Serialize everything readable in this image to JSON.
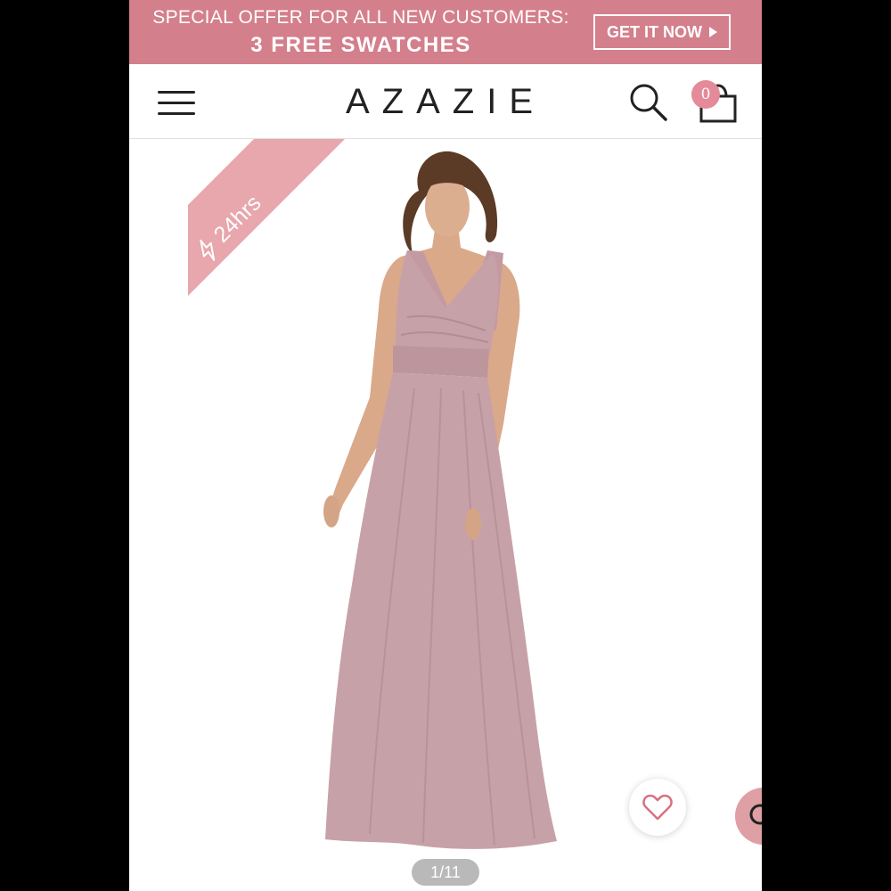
{
  "promo": {
    "line1": "SPECIAL OFFER FOR ALL NEW CUSTOMERS:",
    "line2": "3 FREE SWATCHES",
    "cta_label": "GET IT NOW",
    "background": "#d47f8c"
  },
  "header": {
    "logo": "AZAZIE",
    "cart_count": "0",
    "icons": [
      "hamburger-menu-icon",
      "search-icon",
      "shopping-bag-icon"
    ]
  },
  "product": {
    "badge_label": "24hrs",
    "badge_icon": "lightning-icon",
    "badge_color": "#e8a6ad",
    "dress_color": "#c7a1a8",
    "page_indicator": "1/11"
  },
  "actions": {
    "wishlist_icon": "heart-icon",
    "chat_icon": "chat-bubble-icon",
    "accent": "#d9707f"
  }
}
